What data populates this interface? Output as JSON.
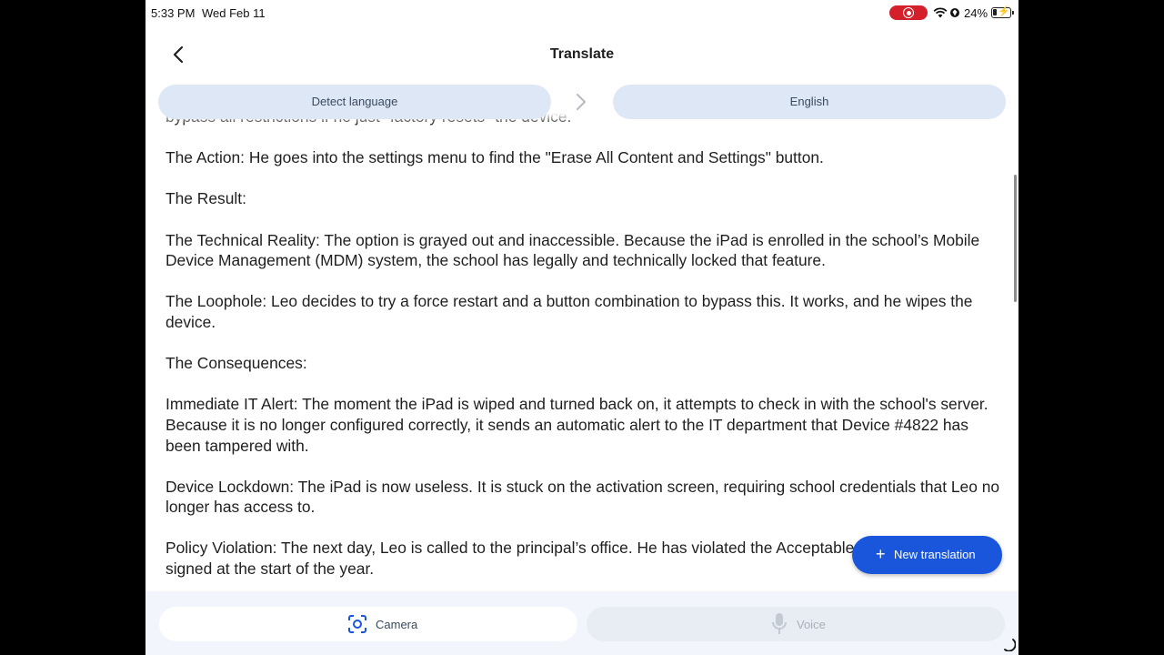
{
  "status_bar": {
    "time": "5:33 PM",
    "date": "Wed Feb 11",
    "battery_percent": "24%",
    "battery_level": 0.24
  },
  "header": {
    "title": "Translate",
    "back_icon": "chevron-left-icon"
  },
  "languages": {
    "source": "Detect language",
    "target": "English",
    "swap_icon": "chevron-right-icon"
  },
  "content": {
    "paragraphs": [
      "bypass all restrictions if he just \"factory resets\" the device.",
      "The Action: He goes into the settings menu to find the \"Erase All Content and Settings\" button.",
      "The Result:",
      "The Technical Reality: The option is grayed out and inaccessible. Because the iPad is enrolled in the school’s Mobile Device Management (MDM) system, the school has legally and technically locked that feature.",
      "The Loophole: Leo decides to try a force restart and a button combination to bypass this. It works, and he wipes the device.",
      "The Consequences:",
      "Immediate IT Alert: The moment the iPad is wiped and turned back on, it attempts to check in with the school's server. Because it is no longer configured correctly, it sends an automatic alert to the IT department that Device #4822 has been tampered with.",
      "Device Lockdown: The iPad is now useless. It is stuck on the activation screen, requiring school credentials that Leo no longer has access to.",
      "Policy Violation: The next day, Leo is called to the principal’s office. He has violated the Acceptable Use Policy he signed at the start of the year."
    ]
  },
  "fab": {
    "label": "New translation",
    "icon": "plus-icon"
  },
  "bottom_bar": {
    "camera_label": "Camera",
    "voice_label": "Voice",
    "camera_icon": "camera-lens-icon",
    "voice_icon": "microphone-icon"
  },
  "colors": {
    "accent": "#1a56db",
    "chip_bg": "#dde7f6",
    "text": "#1f1f1f"
  }
}
